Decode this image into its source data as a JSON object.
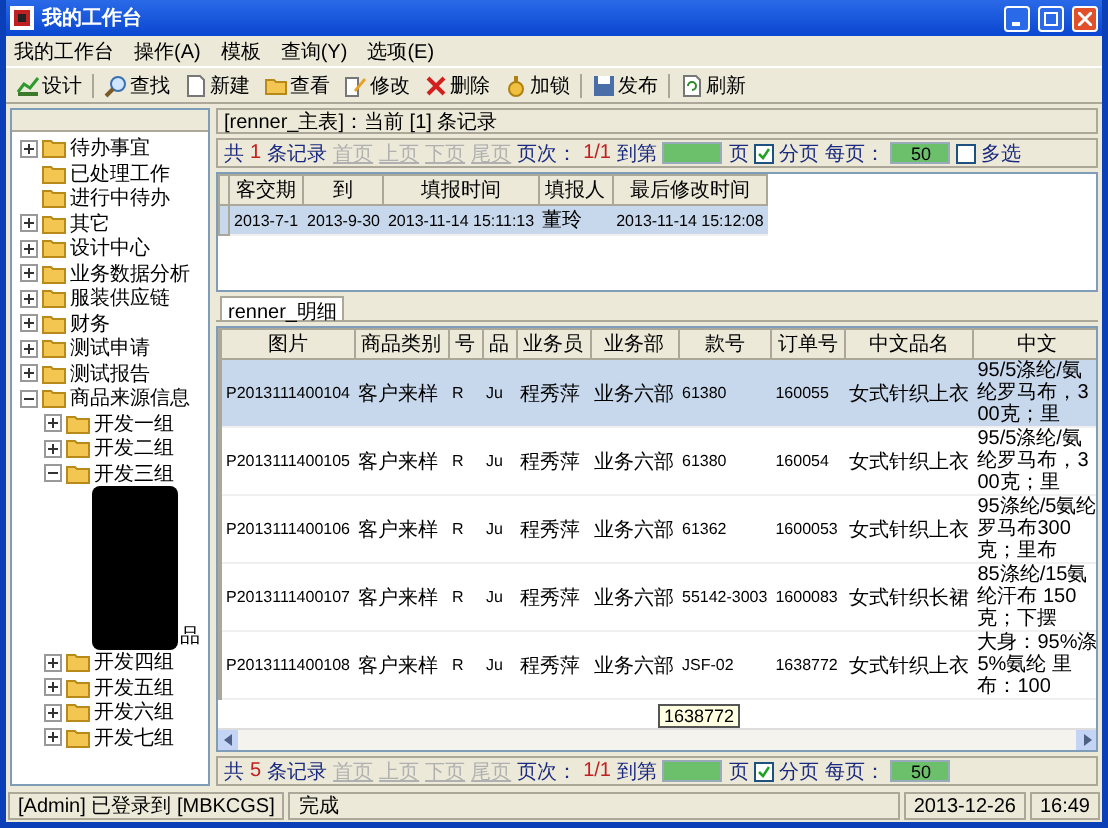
{
  "window": {
    "title": "我的工作台"
  },
  "menu": [
    "我的工作台",
    "操作(A)",
    "模板",
    "查询(Y)",
    "选项(E)"
  ],
  "toolbar": [
    "设计",
    "查找",
    "新建",
    "查看",
    "修改",
    "删除",
    "加锁",
    "发布",
    "刷新"
  ],
  "tree": [
    {
      "label": "待办事宜",
      "kind": "node",
      "expanded": false
    },
    {
      "label": "已处理工作",
      "kind": "leaf"
    },
    {
      "label": "进行中待办",
      "kind": "leaf"
    },
    {
      "label": "其它",
      "kind": "node",
      "expanded": false
    },
    {
      "label": "设计中心",
      "kind": "node",
      "expanded": false
    },
    {
      "label": "业务数据分析",
      "kind": "node",
      "expanded": false
    },
    {
      "label": "服装供应链",
      "kind": "node",
      "expanded": false
    },
    {
      "label": "财务",
      "kind": "node",
      "expanded": false
    },
    {
      "label": "测试申请",
      "kind": "node",
      "expanded": false
    },
    {
      "label": "测试报告",
      "kind": "node",
      "expanded": false
    },
    {
      "label": "商品来源信息",
      "kind": "node",
      "expanded": true,
      "children": [
        {
          "label": "开发一组",
          "kind": "node",
          "expanded": false
        },
        {
          "label": "开发二组",
          "kind": "node",
          "expanded": false
        },
        {
          "label": "开发三组",
          "kind": "node",
          "expanded": true,
          "children": [
            {
              "kind": "redacted",
              "fragment": "品"
            }
          ]
        },
        {
          "label": "开发四组",
          "kind": "node",
          "expanded": false
        },
        {
          "label": "开发五组",
          "kind": "node",
          "expanded": false
        },
        {
          "label": "开发六组",
          "kind": "node",
          "expanded": false
        },
        {
          "label": "开发七组",
          "kind": "node",
          "expanded": false
        }
      ]
    }
  ],
  "master": {
    "caption": "[renner_主表]：当前 [1] 条记录",
    "pager": {
      "total_label": "共",
      "total": "1",
      "records_label": "条记录",
      "nav": [
        {
          "label": "首页",
          "disabled": true
        },
        {
          "label": "上页",
          "disabled": true
        },
        {
          "label": "下页",
          "disabled": true
        },
        {
          "label": "尾页",
          "disabled": true
        }
      ],
      "page_label": "页次：",
      "page": "1/1",
      "goto_label": "到第",
      "goto_suffix": "页",
      "paging": {
        "label": "分页",
        "checked": true
      },
      "per_page_label": "每页：",
      "per_page": "50",
      "multi": {
        "label": "多选",
        "checked": false
      }
    },
    "columns": [
      "客交期",
      "到",
      "填报时间",
      "填报人",
      "最后修改时间"
    ],
    "rows": [
      {
        "selected": true,
        "cells": [
          "2013-7-1",
          "2013-9-30",
          "2013-11-14 15:11:13",
          "董玲",
          "2013-11-14 15:12:08"
        ]
      }
    ]
  },
  "detail": {
    "tabs": [
      {
        "label": "renner_明细",
        "selected": true
      }
    ],
    "columns": [
      "图片",
      "商品类别",
      "号",
      "品",
      "业务员",
      "业务部",
      "款号",
      "订单号",
      "中文品名",
      "中文"
    ],
    "rows": [
      {
        "selected": true,
        "cells": [
          "P2013111400104",
          "客户来样",
          "R",
          "Ju",
          "程秀萍",
          "业务六部",
          "61380",
          "160055",
          "女式针织上衣",
          "95/5涤纶/氨纶罗马布，300克；里"
        ]
      },
      {
        "selected": false,
        "cells": [
          "P2013111400105",
          "客户来样",
          "R",
          "Ju",
          "程秀萍",
          "业务六部",
          "61380",
          "160054",
          "女式针织上衣",
          "95/5涤纶/氨纶罗马布，300克；里"
        ]
      },
      {
        "selected": false,
        "cells": [
          "P2013111400106",
          "客户来样",
          "R",
          "Ju",
          "程秀萍",
          "业务六部",
          "61362",
          "1600053",
          "女式针织上衣",
          "95涤纶/5氨纶罗马布300克；里布"
        ]
      },
      {
        "selected": false,
        "cells": [
          "P2013111400107",
          "客户来样",
          "R",
          "Ju",
          "程秀萍",
          "业务六部",
          "55142-3003",
          "1600083",
          "女式针织长裙",
          "85涤纶/15氨纶汗布 150克；下摆"
        ]
      },
      {
        "selected": false,
        "cells": [
          "P2013111400108",
          "客户来样",
          "R",
          "Ju",
          "程秀萍",
          "业务六部",
          "JSF-02",
          "1638772",
          "女式针织上衣",
          "大身：95%涤5%氨纶 里布：100"
        ]
      }
    ],
    "tooltip": "1638772",
    "pager": {
      "total_label": "共",
      "total": "5",
      "records_label": "条记录",
      "nav": [
        {
          "label": "首页",
          "disabled": true
        },
        {
          "label": "上页",
          "disabled": true
        },
        {
          "label": "下页",
          "disabled": true
        },
        {
          "label": "尾页",
          "disabled": true
        }
      ],
      "page_label": "页次：",
      "page": "1/1",
      "goto_label": "到第",
      "goto_suffix": "页",
      "paging": {
        "label": "分页",
        "checked": true
      },
      "per_page_label": "每页：",
      "per_page": "50"
    }
  },
  "status": [
    "[Admin] 已登录到 [MBKCGS]",
    "完成",
    "2013-12-26",
    "16:49"
  ]
}
